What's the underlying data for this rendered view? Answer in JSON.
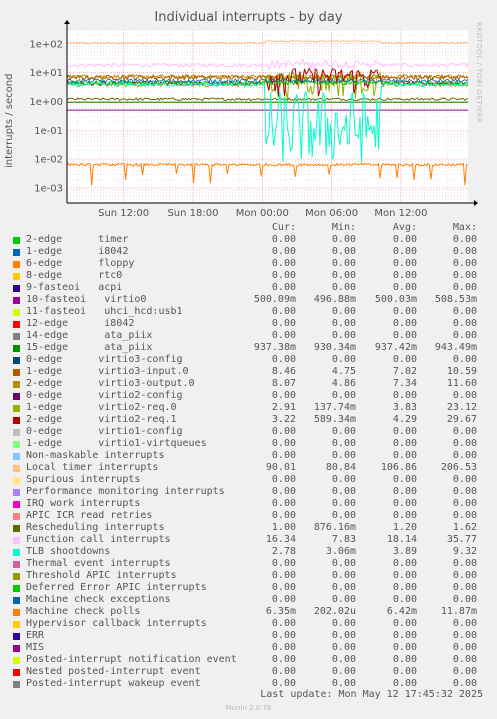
{
  "title": "Individual interrupts - by day",
  "watermark": "RRDTOOL / TOBI OETIKER",
  "footer": "Munin 2.0.76",
  "last_update": "Last update: Mon May 12 17:45:32 2025",
  "legend_headers": {
    "cur": "Cur:",
    "min": "Min:",
    "avg": "Avg:",
    "max": "Max:"
  },
  "chart_data": {
    "type": "line",
    "title": "Individual interrupts - by day",
    "ylabel": "interrupts / second",
    "y_scale": "log",
    "ylim": [
      0.0003,
      300
    ],
    "y_ticks": [
      "1e+02",
      "1e+01",
      "1e+00",
      "1e-01",
      "1e-02",
      "1e-03"
    ],
    "y_tick_values": [
      100,
      10,
      1,
      0.1,
      0.01,
      0.001
    ],
    "x_ticks": [
      "Sun 12:00",
      "Sun 18:00",
      "Mon 00:00",
      "Mon 06:00",
      "Mon 12:00"
    ],
    "x_tick_hours": [
      12,
      18,
      24,
      30,
      36
    ],
    "x_range_hours": [
      7.1,
      41.8
    ],
    "grid": true,
    "series": [
      {
        "name": "2-edge timer",
        "color": "#00cc00",
        "cur": "0.00",
        "min": "0.00",
        "avg": "0.00",
        "max": "0.00"
      },
      {
        "name": "1-edge i8042",
        "color": "#0066b3",
        "cur": "0.00",
        "min": "0.00",
        "avg": "0.00",
        "max": "0.00"
      },
      {
        "name": "6-edge floppy",
        "color": "#ff8000",
        "cur": "0.00",
        "min": "0.00",
        "avg": "0.00",
        "max": "0.00"
      },
      {
        "name": "8-edge rtc0",
        "color": "#ffcc00",
        "cur": "0.00",
        "min": "0.00",
        "avg": "0.00",
        "max": "0.00"
      },
      {
        "name": "9-fasteoi acpi",
        "color": "#330099",
        "cur": "0.00",
        "min": "0.00",
        "avg": "0.00",
        "max": "0.00"
      },
      {
        "name": "10-fasteoi virtio0",
        "color": "#990099",
        "cur": "500.09m",
        "min": "496.88m",
        "avg": "500.03m",
        "max": "508.53m",
        "level": 0.5
      },
      {
        "name": "11-fasteoi uhci_hcd:usb1",
        "color": "#ccff00",
        "cur": "0.00",
        "min": "0.00",
        "avg": "0.00",
        "max": "0.00"
      },
      {
        "name": "12-edge i8042",
        "color": "#ff0000",
        "cur": "0.00",
        "min": "0.00",
        "avg": "0.00",
        "max": "0.00"
      },
      {
        "name": "14-edge ata_piix",
        "color": "#808080",
        "cur": "0.00",
        "min": "0.00",
        "avg": "0.00",
        "max": "0.00"
      },
      {
        "name": "15-edge ata_piix",
        "color": "#008f00",
        "cur": "937.38m",
        "min": "930.34m",
        "avg": "937.42m",
        "max": "943.49m",
        "level": 0.937
      },
      {
        "name": "0-edge virtio3-config",
        "color": "#00487d",
        "cur": "0.00",
        "min": "0.00",
        "avg": "0.00",
        "max": "0.00"
      },
      {
        "name": "1-edge virtio3-input.0",
        "color": "#b35a00",
        "cur": "8.46",
        "min": "4.75",
        "avg": "7.02",
        "max": "10.59",
        "level": 7.0
      },
      {
        "name": "2-edge virtio3-output.0",
        "color": "#b38f00",
        "cur": "8.07",
        "min": "4.86",
        "avg": "7.34",
        "max": "11.60",
        "level": 7.3
      },
      {
        "name": "0-edge virtio2-config",
        "color": "#6b006b",
        "cur": "0.00",
        "min": "0.00",
        "avg": "0.00",
        "max": "0.00"
      },
      {
        "name": "1-edge virtio2-req.0",
        "color": "#8fb300",
        "cur": "2.91",
        "min": "137.74m",
        "avg": "3.83",
        "max": "23.12",
        "level": 3.8
      },
      {
        "name": "2-edge virtio2-req.1",
        "color": "#b30000",
        "cur": "3.22",
        "min": "589.34m",
        "avg": "4.29",
        "max": "29.67",
        "level": 4.3
      },
      {
        "name": "0-edge virtio1-config",
        "color": "#bebebe",
        "cur": "0.00",
        "min": "0.00",
        "avg": "0.00",
        "max": "0.00"
      },
      {
        "name": "1-edge virtio1-virtqueues",
        "color": "#80ff80",
        "cur": "0.00",
        "min": "0.00",
        "avg": "0.00",
        "max": "0.00"
      },
      {
        "name": "Non-maskable interrupts",
        "color": "#80c9ff",
        "cur": "0.00",
        "min": "0.00",
        "avg": "0.00",
        "max": "0.00"
      },
      {
        "name": "Local timer interrupts",
        "color": "#ffc080",
        "cur": "90.01",
        "min": "80.84",
        "avg": "106.86",
        "max": "206.53",
        "level": 106.86
      },
      {
        "name": "Spurious interrupts",
        "color": "#ffe680",
        "cur": "0.00",
        "min": "0.00",
        "avg": "0.00",
        "max": "0.00"
      },
      {
        "name": "Performance monitoring interrupts",
        "color": "#aa80ff",
        "cur": "0.00",
        "min": "0.00",
        "avg": "0.00",
        "max": "0.00"
      },
      {
        "name": "IRQ work interrupts",
        "color": "#ee00cc",
        "cur": "0.00",
        "min": "0.00",
        "avg": "0.00",
        "max": "0.00"
      },
      {
        "name": "APIC ICR read retries",
        "color": "#ff8080",
        "cur": "0.00",
        "min": "0.00",
        "avg": "0.00",
        "max": "0.00"
      },
      {
        "name": "Rescheduling interrupts",
        "color": "#666600",
        "cur": "1.00",
        "min": "876.16m",
        "avg": "1.20",
        "max": "1.62",
        "level": 1.2
      },
      {
        "name": "Function call interrupts",
        "color": "#ffbfff",
        "cur": "16.34",
        "min": "7.83",
        "avg": "18.14",
        "max": "35.77",
        "level": 18.14
      },
      {
        "name": "TLB shootdowns",
        "color": "#00ffcc",
        "cur": "2.78",
        "min": "3.06m",
        "avg": "3.89",
        "max": "9.32",
        "level": 3.89
      },
      {
        "name": "Thermal event interrupts",
        "color": "#cc6699",
        "cur": "0.00",
        "min": "0.00",
        "avg": "0.00",
        "max": "0.00"
      },
      {
        "name": "Threshold APIC interrupts",
        "color": "#999900",
        "cur": "0.00",
        "min": "0.00",
        "avg": "0.00",
        "max": "0.00"
      },
      {
        "name": "Deferred Error APIC interrupts",
        "color": "#00cc00",
        "cur": "0.00",
        "min": "0.00",
        "avg": "0.00",
        "max": "0.00"
      },
      {
        "name": "Machine check exceptions",
        "color": "#0066b3",
        "cur": "0.00",
        "min": "0.00",
        "avg": "0.00",
        "max": "0.00"
      },
      {
        "name": "Machine check polls",
        "color": "#ff8000",
        "cur": "6.35m",
        "min": "202.02u",
        "avg": "6.42m",
        "max": "11.87m",
        "level": 0.0064
      },
      {
        "name": "Hypervisor callback interrupts",
        "color": "#ffcc00",
        "cur": "0.00",
        "min": "0.00",
        "avg": "0.00",
        "max": "0.00"
      },
      {
        "name": "ERR",
        "color": "#330099",
        "cur": "0.00",
        "min": "0.00",
        "avg": "0.00",
        "max": "0.00"
      },
      {
        "name": "MIS",
        "color": "#990099",
        "cur": "0.00",
        "min": "0.00",
        "avg": "0.00",
        "max": "0.00"
      },
      {
        "name": "Posted-interrupt notification event",
        "color": "#ccff00",
        "cur": "0.00",
        "min": "0.00",
        "avg": "0.00",
        "max": "0.00"
      },
      {
        "name": "Nested posted-interrupt event",
        "color": "#ff0000",
        "cur": "0.00",
        "min": "0.00",
        "avg": "0.00",
        "max": "0.00"
      },
      {
        "name": "Posted-interrupt wakeup event",
        "color": "#808080",
        "cur": "0.00",
        "min": "0.00",
        "avg": "0.00",
        "max": "0.00"
      }
    ]
  },
  "legend_labels": [
    "2-edge      timer",
    "1-edge      i8042",
    "6-edge      floppy",
    "8-edge      rtc0",
    "9-fasteoi   acpi",
    "10-fasteoi   virtio0",
    "11-fasteoi   uhci_hcd:usb1",
    "12-edge      i8042",
    "14-edge      ata_piix",
    "15-edge      ata_piix",
    "0-edge      virtio3-config",
    "1-edge      virtio3-input.0",
    "2-edge      virtio3-output.0",
    "0-edge      virtio2-config",
    "1-edge      virtio2-req.0",
    "2-edge      virtio2-req.1",
    "0-edge      virtio1-config",
    "1-edge      virtio1-virtqueues",
    "Non-maskable interrupts",
    "Local timer interrupts",
    "Spurious interrupts",
    "Performance monitoring interrupts",
    "IRQ work interrupts",
    "APIC ICR read retries",
    "Rescheduling interrupts",
    "Function call interrupts",
    "TLB shootdowns",
    "Thermal event interrupts",
    "Threshold APIC interrupts",
    "Deferred Error APIC interrupts",
    "Machine check exceptions",
    "Machine check polls",
    "Hypervisor callback interrupts",
    "ERR",
    "MIS",
    "Posted-interrupt notification event",
    "Nested posted-interrupt event",
    "Posted-interrupt wakeup event"
  ]
}
